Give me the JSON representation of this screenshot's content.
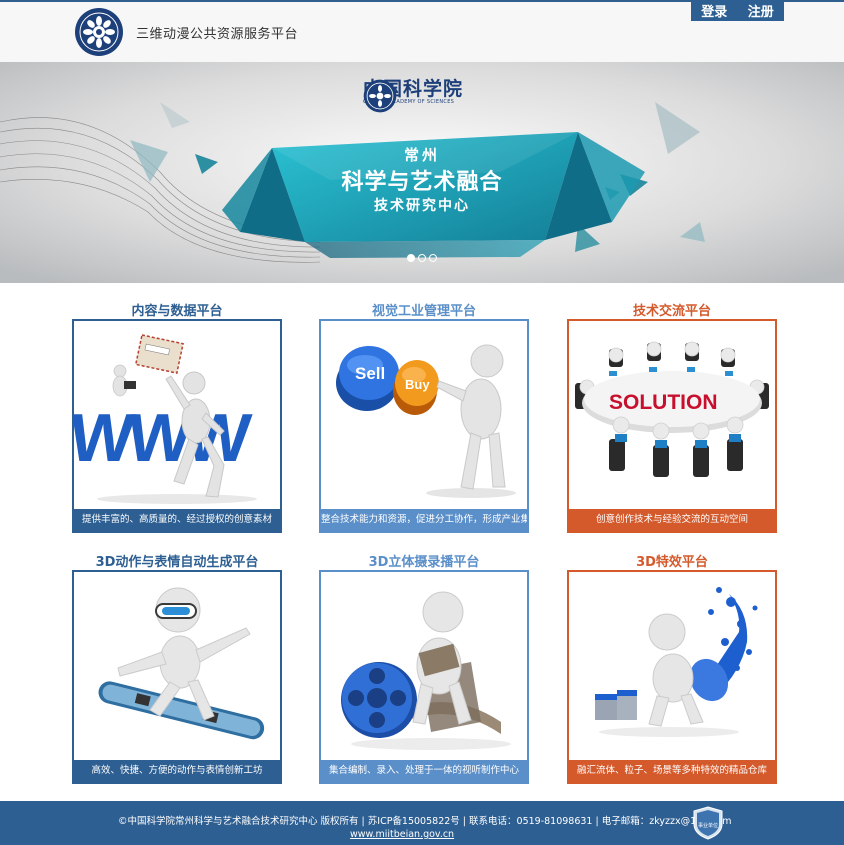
{
  "header": {
    "site_title": "三维动漫公共资源服务平台",
    "login": "登录",
    "register": "注册",
    "logo_icon": "cas-logo-icon"
  },
  "banner": {
    "logo_cn": "中国科学院",
    "logo_en": "CHINESE ACADEMY OF SCIENCES",
    "line1": "常州",
    "line2": "科学与艺术融合",
    "line3": "技术研究中心",
    "slides": 3,
    "active_slide": 1
  },
  "cards": [
    {
      "title": "内容与数据平台",
      "caption": "提供丰富的、高质量的、经过授权的创意素材",
      "color": "#2e5f92",
      "icon": "www-figure-icon"
    },
    {
      "title": "视觉工业管理平台",
      "caption": "整合技术能力和资源，促进分工协作，形成产业集聚",
      "color": "#5b8fc9",
      "icon": "sell-buy-buttons-icon"
    },
    {
      "title": "技术交流平台",
      "caption": "创意创作技术与经验交流的互动空间",
      "color": "#d45a2c",
      "icon": "solution-table-icon"
    },
    {
      "title": "3D动作与表情自动生成平台",
      "caption": "高效、快捷、方便的动作与表情创新工坊",
      "color": "#2e5f92",
      "icon": "snowboard-figure-icon"
    },
    {
      "title": "3D立体摄录播平台",
      "caption": "集合编制、录入、处理于一体的视听制作中心",
      "color": "#5b8fc9",
      "icon": "film-reel-icon"
    },
    {
      "title": "3D特效平台",
      "caption": "融汇流体、粒子、场景等多种特效的精品仓库",
      "color": "#d45a2c",
      "icon": "paint-splash-icon"
    }
  ],
  "footer": {
    "line": "©中国科学院常州科学与艺术融合技术研究中心 版权所有 | 苏ICP备15005822号 | 联系电话：0519-81098631 | 电子邮箱：zkyzzx@163.com",
    "link": "www.miitbeian.gov.cn",
    "badge_text": "事业单位",
    "badge_icon": "government-badge-icon"
  },
  "colors": {
    "primary": "#2e5f92",
    "light_blue": "#5b8fc9",
    "orange": "#d45a2c",
    "teal": "#1aa4b8"
  }
}
